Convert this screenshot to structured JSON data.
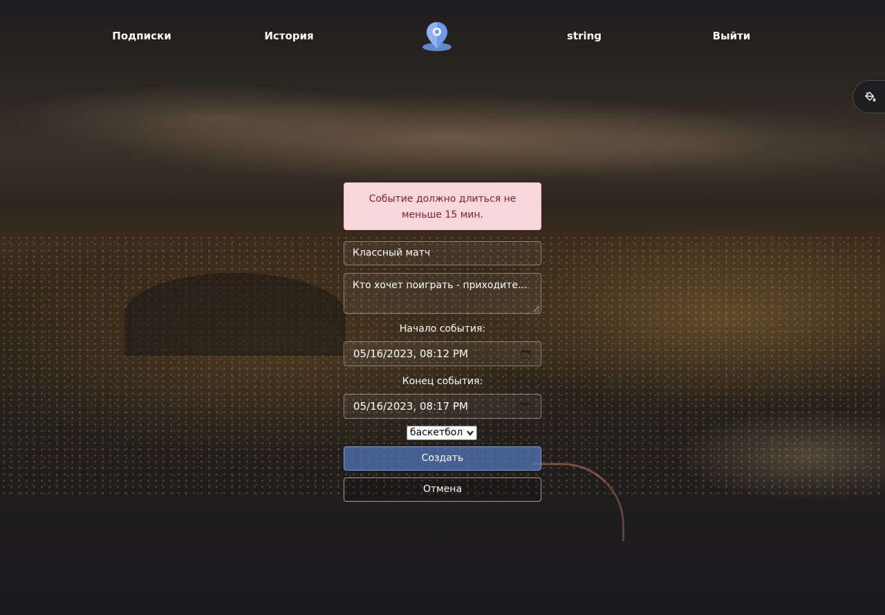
{
  "nav": {
    "subscriptions_label": "Подписки",
    "history_label": "История",
    "username": "string",
    "logout_label": "Выйти"
  },
  "form": {
    "alert_text": "Событие должно длиться не меньше 15 мин.",
    "title_value": "Классный матч",
    "description_value": "Кто хочет поиграть - приходите...",
    "start_label": "Начало события:",
    "start_value": "05/16/2023, 08:12 PM",
    "end_label": "Конец события:",
    "end_value": "05/16/2023, 08:17 PM",
    "sport_selected": "баскетбол",
    "create_label": "Создать",
    "cancel_label": "Отмена"
  },
  "colors": {
    "alert_bg": "#f8d7da",
    "alert_text": "#842029",
    "primary_button": "#5278be",
    "logo_pin": "#6f9ae8"
  },
  "icons": {
    "logo": "map-pin-icon",
    "theme_toggle": "paint-bucket-icon",
    "calendar": "calendar-icon",
    "select_arrow": "chevron-down-icon"
  }
}
